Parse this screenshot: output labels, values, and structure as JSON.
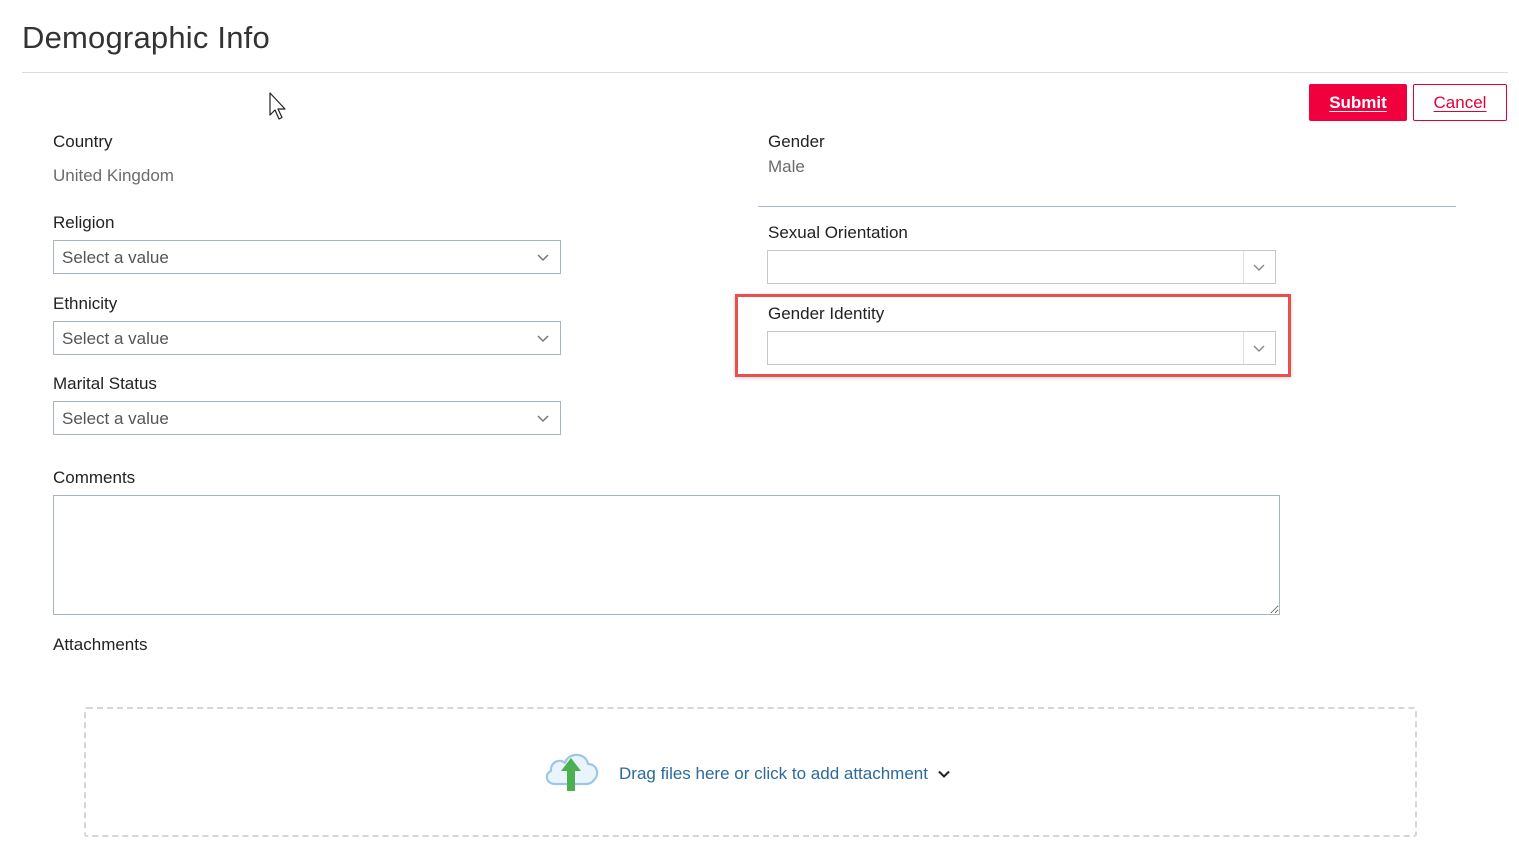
{
  "page": {
    "title": "Demographic Info"
  },
  "actions": {
    "submit_label": "Submit",
    "cancel_label": "Cancel"
  },
  "left": {
    "country_label": "Country",
    "country_value": "United Kingdom",
    "religion_label": "Religion",
    "religion_placeholder": "Select a value",
    "ethnicity_label": "Ethnicity",
    "ethnicity_placeholder": "Select a value",
    "marital_label": "Marital Status",
    "marital_placeholder": "Select a value"
  },
  "right": {
    "gender_label": "Gender",
    "gender_value": "Male",
    "sexual_orientation_label": "Sexual Orientation",
    "sexual_orientation_value": "",
    "gender_identity_label": "Gender Identity",
    "gender_identity_value": ""
  },
  "comments": {
    "label": "Comments",
    "value": ""
  },
  "attachments": {
    "label": "Attachments",
    "dropzone_text": "Drag files here or click to add attachment"
  },
  "colors": {
    "accent": "#f0003c",
    "highlight": "#e8504e",
    "link": "#2b6a9b",
    "upload_arrow": "#4caf50",
    "cloud": "#9cc7e6"
  },
  "icons": [
    "chevron-down-icon",
    "cloud-upload-icon",
    "mouse-cursor-icon"
  ]
}
